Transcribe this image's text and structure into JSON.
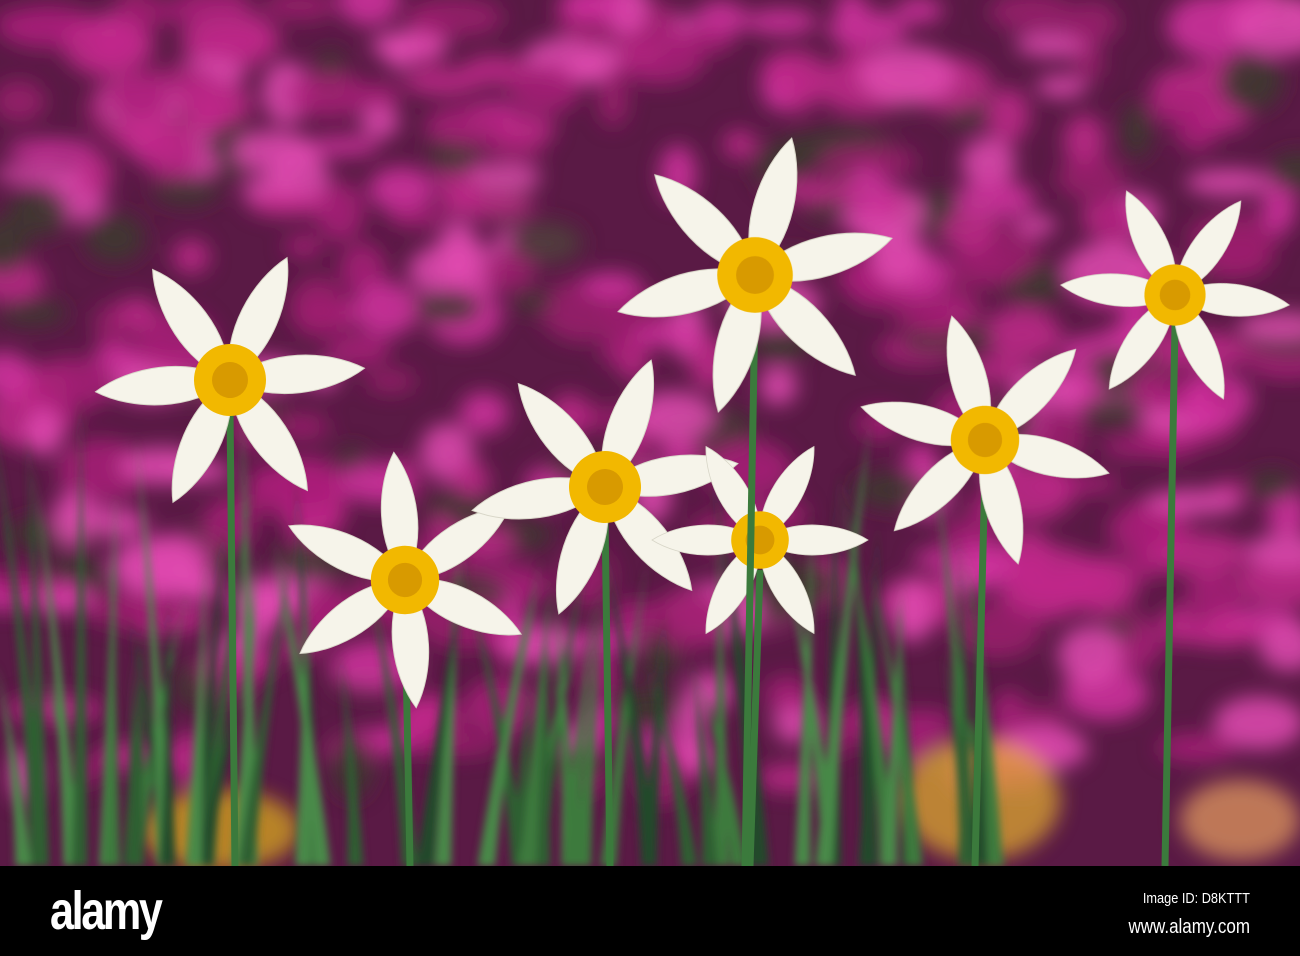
{
  "photo": {
    "subject": "white daffodils in front of magenta rhododendrons",
    "colors": {
      "background": "#b0207a",
      "foliage": "#2f5a2e",
      "petal": "#f6f4ea",
      "cup": "#f2b800"
    }
  },
  "footer": {
    "logo": "alamy",
    "image_id": "Image ID: D8KTTT",
    "url": "www.alamy.com"
  }
}
